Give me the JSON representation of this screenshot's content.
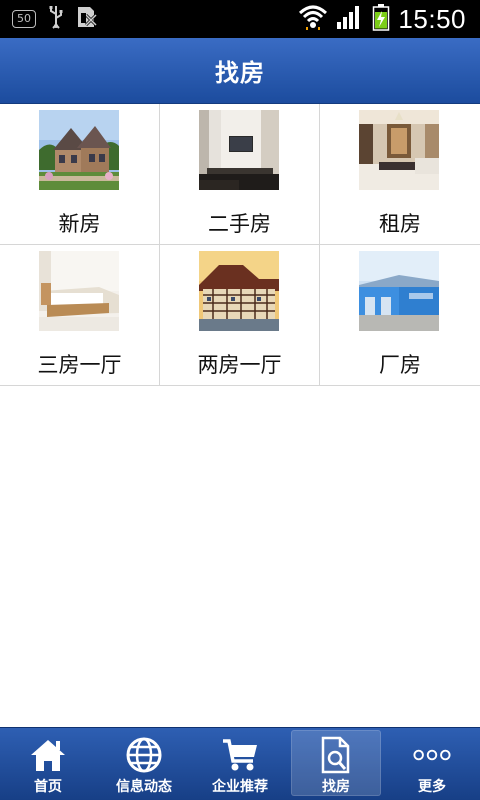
{
  "status_bar": {
    "battery_badge": "50",
    "time": "15:50"
  },
  "header": {
    "title": "找房"
  },
  "categories": [
    {
      "label": "新房",
      "icon": "house-exterior-photo"
    },
    {
      "label": "二手房",
      "icon": "living-room-photo"
    },
    {
      "label": "租房",
      "icon": "interior-photo"
    },
    {
      "label": "三房一厅",
      "icon": "bedroom-photo"
    },
    {
      "label": "两房一厅",
      "icon": "timber-house-photo"
    },
    {
      "label": "厂房",
      "icon": "factory-photo"
    }
  ],
  "bottom_nav": {
    "items": [
      {
        "label": "首页",
        "icon": "home-icon"
      },
      {
        "label": "信息动态",
        "icon": "globe-icon"
      },
      {
        "label": "企业推荐",
        "icon": "cart-icon"
      },
      {
        "label": "找房",
        "icon": "document-search-icon",
        "active": true
      },
      {
        "label": "更多",
        "icon": "more-dots-icon"
      }
    ]
  },
  "colors": {
    "header_top": "#3a6cc4",
    "header_bottom": "#1c4c9e",
    "nav_bg": "#2e5fb3",
    "grid_border": "#d6d6d6"
  }
}
